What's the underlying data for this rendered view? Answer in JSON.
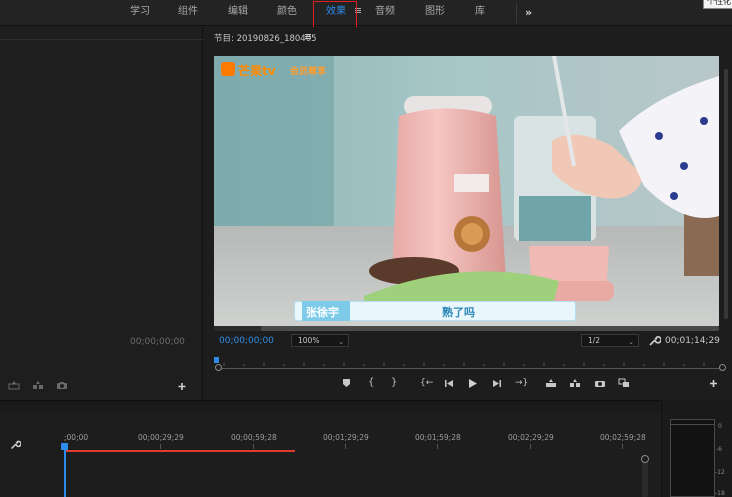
{
  "workspace_tabs": [
    {
      "label": "学习",
      "active": false
    },
    {
      "label": "组件",
      "active": false
    },
    {
      "label": "编辑",
      "active": false
    },
    {
      "label": "颜色",
      "active": false
    },
    {
      "label": "效果",
      "active": true
    },
    {
      "label": "音频",
      "active": false
    },
    {
      "label": "图形",
      "active": false
    },
    {
      "label": "库",
      "active": false
    }
  ],
  "more_workspaces_icon": "»",
  "tooltip_text": "个性化",
  "left_panel": {
    "timecode": "00;00;00;00"
  },
  "program_monitor": {
    "title": "节目: 20190826_180405",
    "current_timecode": "00;00;00;00",
    "zoom": "100%",
    "resolution": "1/2",
    "duration_timecode": "00;01;14;29",
    "video": {
      "watermark": "芒果tv",
      "watermark_sub": "会员尊享",
      "caption_name": "张徐宇",
      "caption_text": "熟了吗"
    }
  },
  "transport_icons": [
    "marker-icon",
    "mark-in-icon",
    "mark-out-icon",
    "go-to-in-icon",
    "step-back-icon",
    "play-icon",
    "step-forward-icon",
    "go-to-out-icon",
    "lift-icon",
    "extract-icon",
    "export-frame-icon",
    "comparison-view-icon",
    "add-button-icon"
  ],
  "timeline": {
    "ruler_labels": [
      ";00;00",
      "00;00;29;29",
      "00;00;59;28",
      "00;01;29;29",
      "00;01;59;28",
      "00;02;29;29",
      "00;02;59;28"
    ]
  },
  "audio_meter": {
    "labels": [
      "0",
      "-6",
      "-12",
      "-18"
    ]
  },
  "colors": {
    "accent": "#2d8ceb",
    "highlight_box": "#e02020",
    "work_area": "#e03b2f"
  }
}
